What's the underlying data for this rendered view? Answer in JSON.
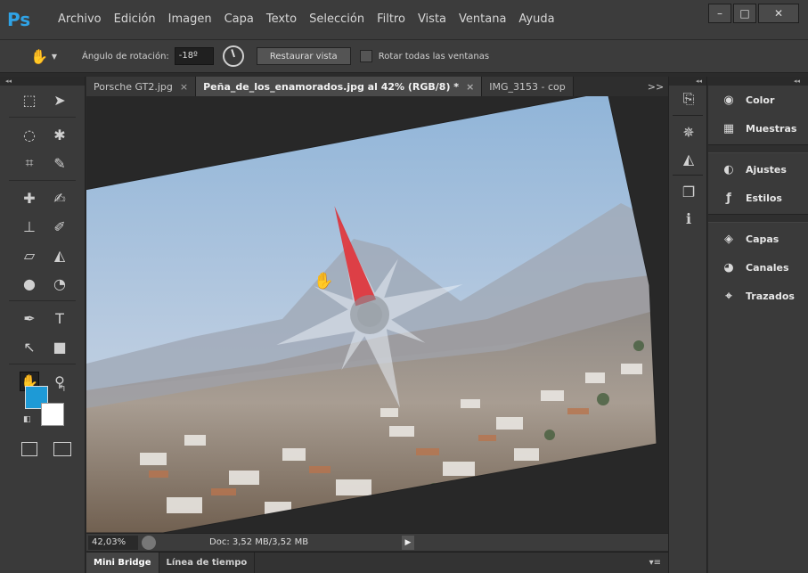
{
  "app": {
    "logo": "Ps",
    "menu": [
      "Archivo",
      "Edición",
      "Imagen",
      "Capa",
      "Texto",
      "Selección",
      "Filtro",
      "Vista",
      "Ventana",
      "Ayuda"
    ],
    "window_controls": {
      "minimize": "–",
      "maximize": "□",
      "close": "✕"
    }
  },
  "options_bar": {
    "rotation_label": "Ángulo de rotación:",
    "rotation_value": "-18º",
    "reset_view": "Restaurar vista",
    "rotate_all_windows": "Rotar todas las ventanas",
    "rotate_all_checked": false
  },
  "doc_tabs": [
    {
      "label": "Porsche GT2.jpg",
      "close": "×",
      "active": false
    },
    {
      "label": "Peña_de_los_enamorados.jpg al 42% (RGB/8) *",
      "close": "×",
      "active": true
    },
    {
      "label": "IMG_3153 - cop",
      "close": "",
      "active": false
    }
  ],
  "tabs_overflow": ">>",
  "toolbar": {
    "collapse": "◂◂",
    "foreground_color": "#1e9ad6",
    "background_color": "#ffffff",
    "tools": [
      [
        "marquee-icon",
        "move-icon"
      ],
      [
        "lasso-icon",
        "magic-wand-icon"
      ],
      [
        "crop-icon",
        "eyedropper-icon"
      ],
      [
        "healing-brush-icon",
        "brush-icon"
      ],
      [
        "clone-stamp-icon",
        "history-brush-icon"
      ],
      [
        "eraser-icon",
        "paint-bucket-icon"
      ],
      [
        "blur-icon",
        "dodge-icon"
      ],
      [
        "pen-icon",
        "type-icon"
      ],
      [
        "path-selection-icon",
        "rectangle-icon"
      ],
      [
        "rotate-view-icon",
        "zoom-icon"
      ]
    ],
    "tool_glyphs": {
      "marquee-icon": "⬚",
      "move-icon": "➤",
      "lasso-icon": "◌",
      "magic-wand-icon": "✱",
      "crop-icon": "⌗",
      "eyedropper-icon": "✎",
      "healing-brush-icon": "✚",
      "brush-icon": "✍",
      "clone-stamp-icon": "⊥",
      "history-brush-icon": "✐",
      "eraser-icon": "▱",
      "paint-bucket-icon": "◭",
      "blur-icon": "●",
      "dodge-icon": "◔",
      "pen-icon": "✒",
      "type-icon": "T",
      "path-selection-icon": "↖",
      "rectangle-icon": "■",
      "rotate-view-icon": "✋",
      "zoom-icon": "⚲"
    }
  },
  "status_bar": {
    "zoom": "42,03%",
    "doc_info": "Doc: 3,52 MB/3,52 MB",
    "arrow": "▶"
  },
  "bottom_panels": {
    "tabs": [
      "Mini Bridge",
      "Línea de tiempo"
    ],
    "menu": "▾≡"
  },
  "icon_strip": {
    "collapse": "◂◂",
    "groups": [
      [
        "history-icon"
      ],
      [
        "navigator-icon",
        "histogram-icon"
      ],
      [
        "layer-comps-icon",
        "info-icon"
      ]
    ],
    "glyphs": {
      "history-icon": "⎘",
      "navigator-icon": "✵",
      "histogram-icon": "◭",
      "layer-comps-icon": "❐",
      "info-icon": "ℹ"
    }
  },
  "panel_column": {
    "collapse": "◂◂",
    "groups": [
      [
        {
          "label": "Color",
          "icon": "color-icon",
          "glyph": "◉"
        },
        {
          "label": "Muestras",
          "icon": "swatches-icon",
          "glyph": "▦"
        }
      ],
      [
        {
          "label": "Ajustes",
          "icon": "adjustments-icon",
          "glyph": "◐"
        },
        {
          "label": "Estilos",
          "icon": "styles-icon",
          "glyph": "ƒ"
        }
      ],
      [
        {
          "label": "Capas",
          "icon": "layers-icon",
          "glyph": "◈"
        },
        {
          "label": "Canales",
          "icon": "channels-icon",
          "glyph": "◕"
        },
        {
          "label": "Trazados",
          "icon": "paths-icon",
          "glyph": "⌖"
        }
      ]
    ]
  },
  "canvas": {
    "rotation_degrees": -18,
    "compass_needle_color": "#e0262b"
  }
}
